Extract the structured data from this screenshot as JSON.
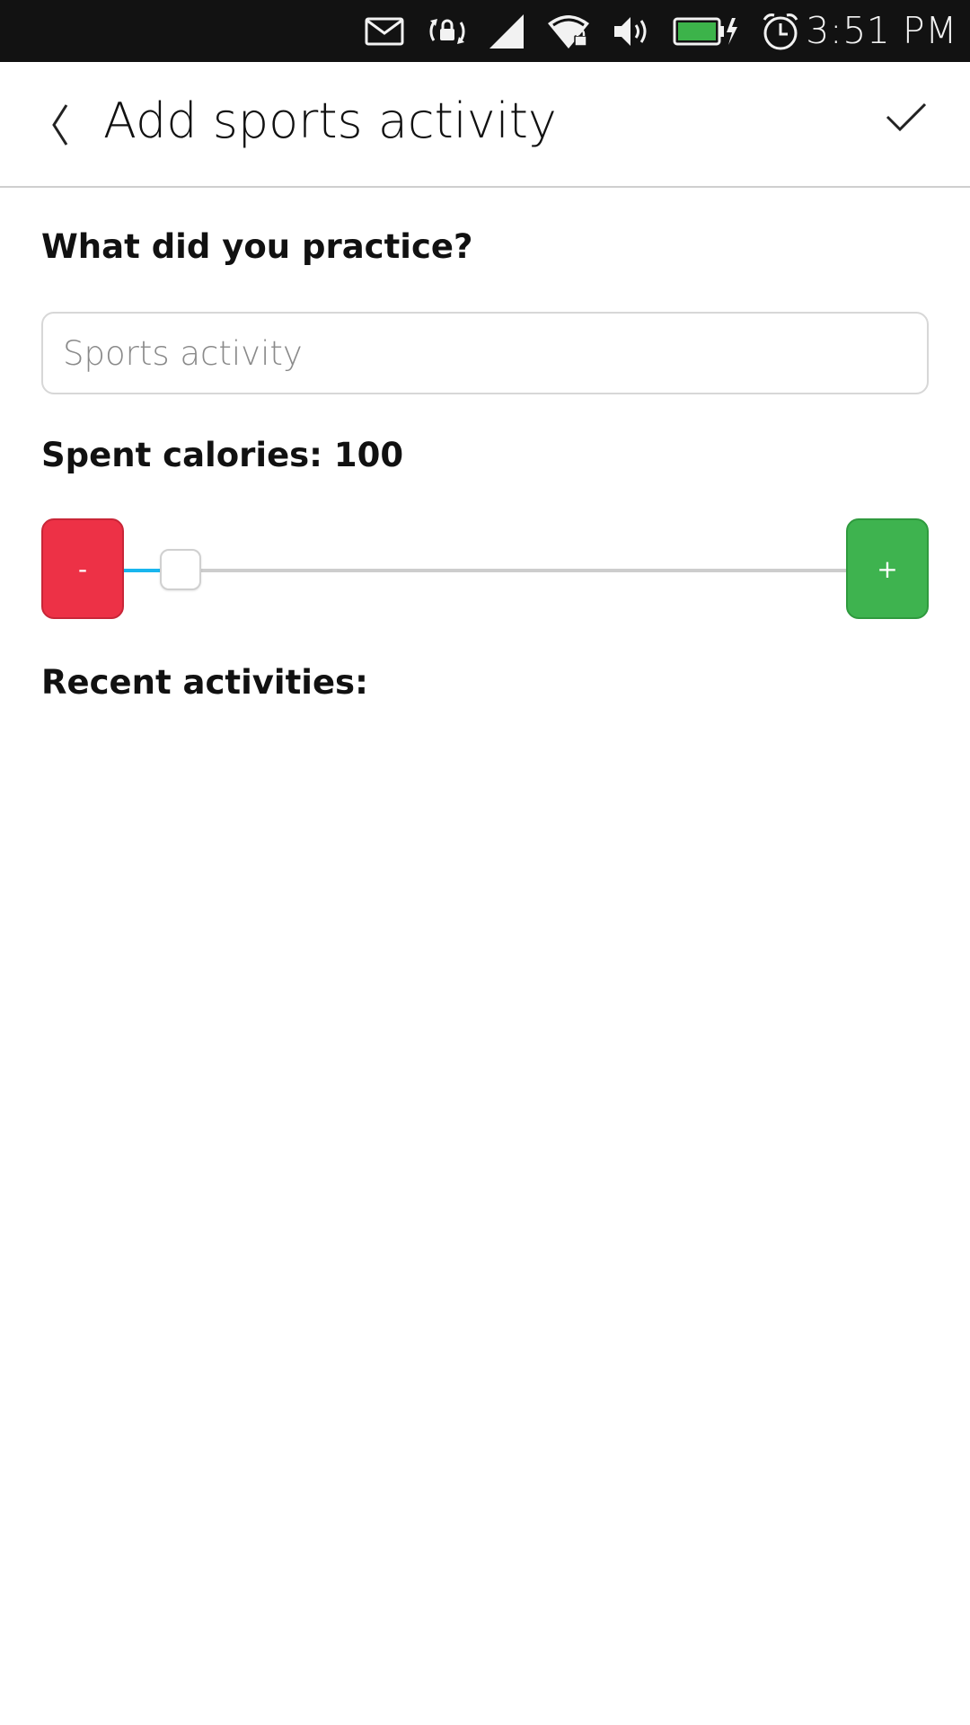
{
  "status_bar": {
    "time": "3:51 PM",
    "icons": [
      "mail-icon",
      "rotation-lock-icon",
      "cellular-signal-icon",
      "wifi-icon",
      "volume-icon",
      "battery-charging-icon",
      "alarm-icon"
    ],
    "battery_color": "#3cb34a"
  },
  "header": {
    "title": "Add sports activity"
  },
  "form": {
    "practice_label": "What did you practice?",
    "activity_placeholder": "Sports activity",
    "activity_value": "",
    "calories_label": "Spent calories: 100",
    "calories_value": 100,
    "slider_fraction": 0.05,
    "minus_label": "-",
    "plus_label": "+",
    "recent_label": "Recent activities:"
  },
  "colors": {
    "minus": "#ed3146",
    "plus": "#3eb34f",
    "slider_fill": "#19b6ee"
  }
}
